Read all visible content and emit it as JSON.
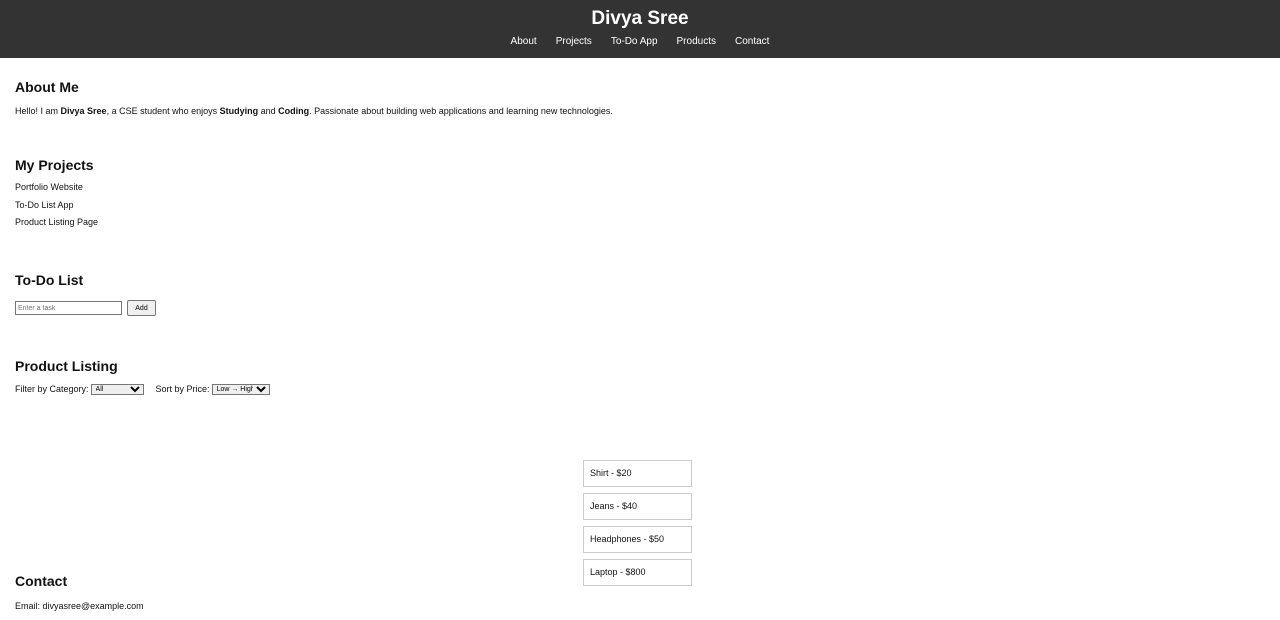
{
  "header": {
    "title": "Divya Sree",
    "nav": [
      "About",
      "Projects",
      "To-Do App",
      "Products",
      "Contact"
    ]
  },
  "about": {
    "heading": "About Me",
    "text_1": "Hello! I am ",
    "name_bold": "Divya Sree",
    "text_2": ", a CSE student who enjoys ",
    "bold_1": "Studying",
    "text_3": " and ",
    "bold_2": "Coding",
    "text_4": ". Passionate about building web applications and learning new technologies."
  },
  "projects": {
    "heading": "My Projects",
    "items": [
      "Portfolio Website",
      "To-Do List App",
      "Product Listing Page"
    ]
  },
  "todo": {
    "heading": "To-Do List",
    "input_placeholder": "Enter a task",
    "add_label": "Add"
  },
  "products": {
    "heading": "Product Listing",
    "filter_label": "Filter by Category:",
    "filter_value": "All",
    "sort_label": "Sort by Price:",
    "sort_value": "Low → High",
    "items": [
      "Shirt - $20",
      "Jeans - $40",
      "Headphones - $50",
      "Laptop - $800"
    ]
  },
  "contact": {
    "heading": "Contact",
    "email_text": "Email: divyasree@example.com"
  },
  "colors": {
    "header_bg": "#333333",
    "card_border": "#cccccc"
  }
}
